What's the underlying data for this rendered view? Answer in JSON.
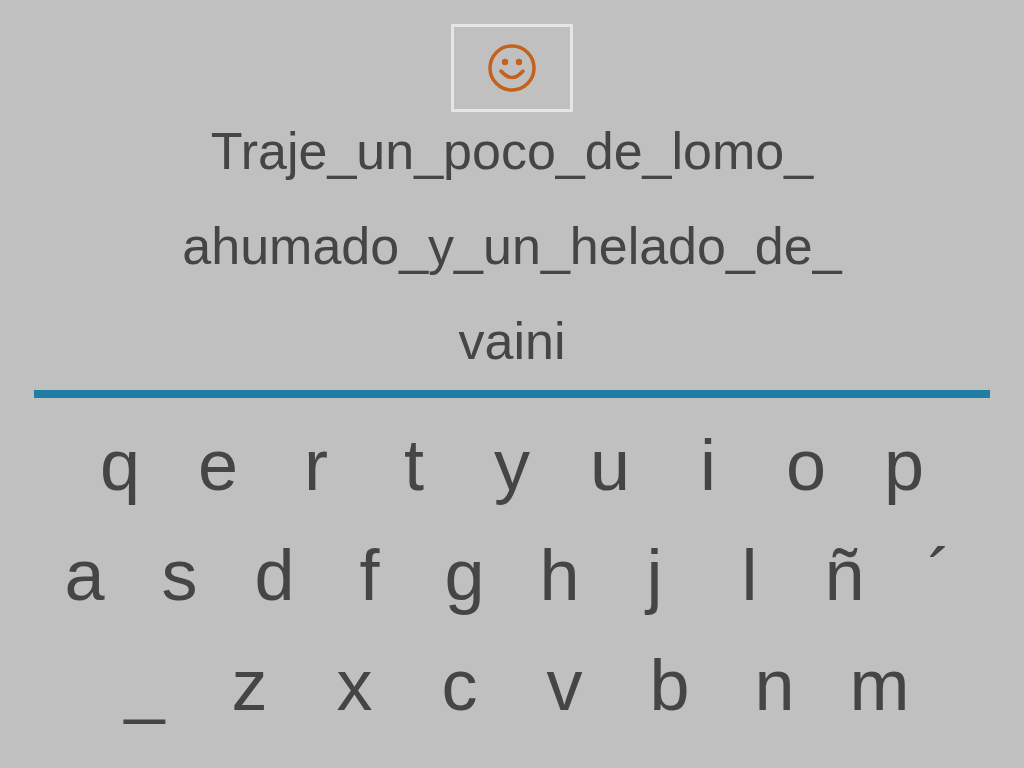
{
  "feedback": {
    "kind": "smiley"
  },
  "sentence_lines": [
    "Traje_un_poco_de_lomo_",
    "ahumado_y_un_helado_de_",
    "vaini"
  ],
  "keyboard_rows": [
    [
      "q",
      "e",
      "r",
      "t",
      "y",
      "u",
      "i",
      "o",
      "p"
    ],
    [
      "a",
      "s",
      "d",
      "f",
      "g",
      "h",
      "j",
      "l",
      "ñ",
      "´"
    ],
    [
      "_",
      "z",
      "x",
      "c",
      "v",
      "b",
      "n",
      "m"
    ]
  ]
}
